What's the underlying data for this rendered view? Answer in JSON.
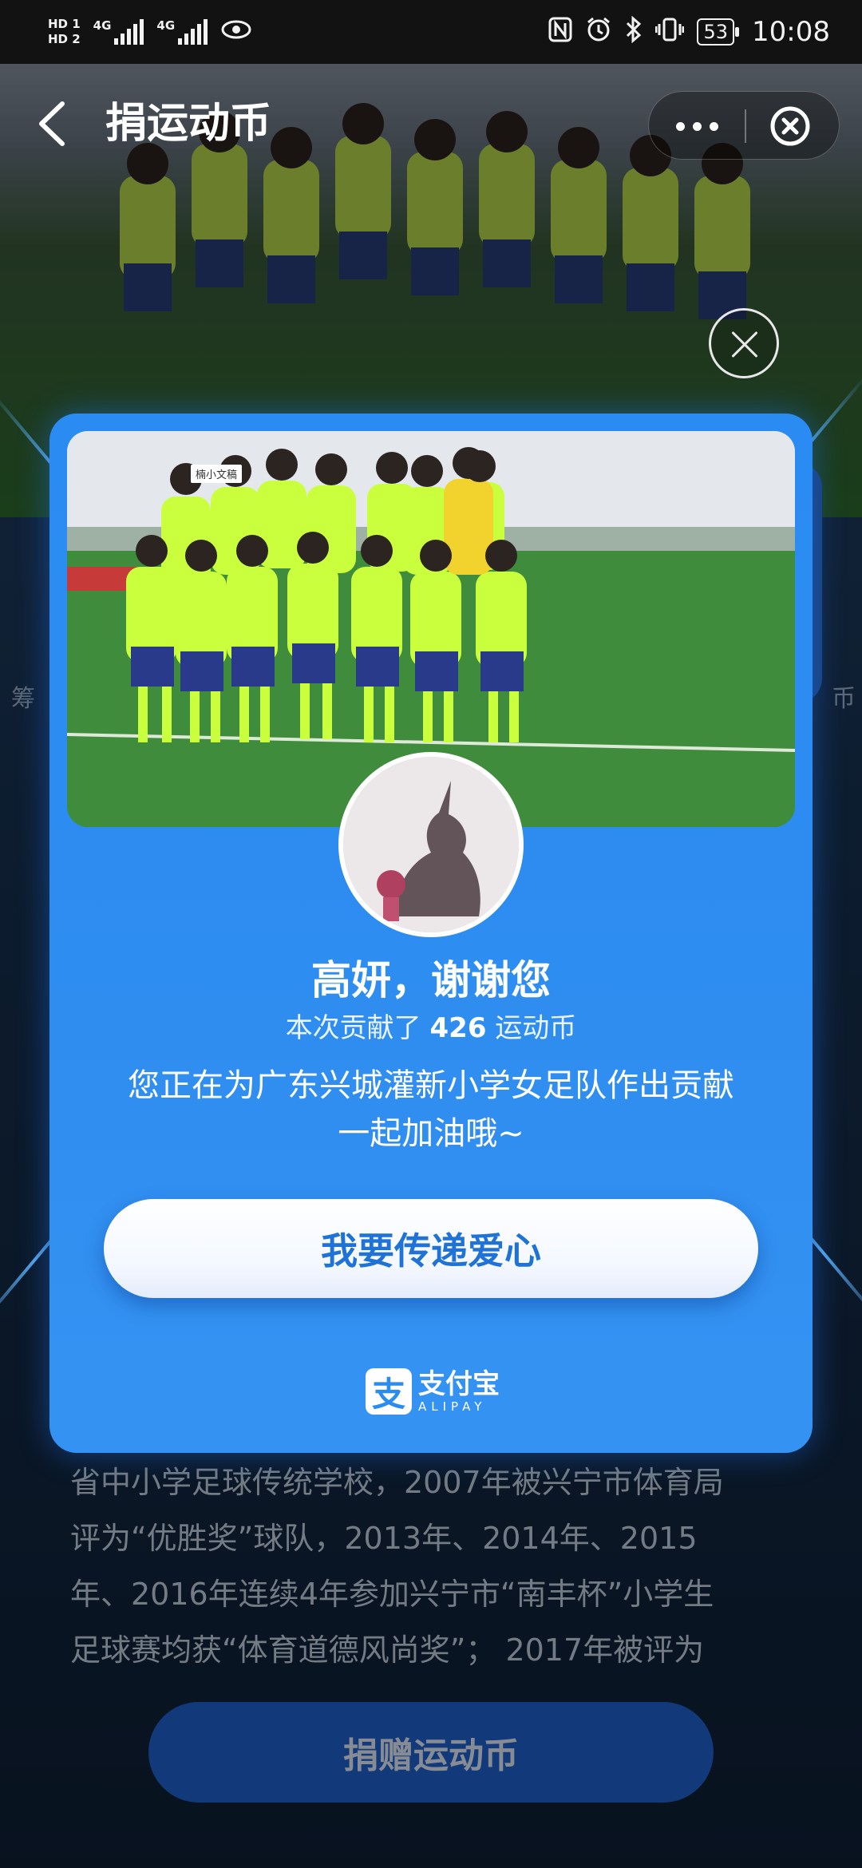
{
  "status_bar": {
    "hd1": "HD 1",
    "hd2": "HD 2",
    "net1": "4G",
    "net2": "4G",
    "battery": "53",
    "time": "10:08"
  },
  "header": {
    "title": "捐运动币"
  },
  "background": {
    "side_left": "筹",
    "side_right": "币",
    "text_lines": [
      "省中小学足球传统学校，2007年被兴宁市体育局",
      "评为“优胜奖”球队，2013年、2014年、2015",
      "年、2016年连续4年参加兴宁市“南丰杯”小学生",
      "足球赛均获“体育道德风尚奖”； 2017年被评为"
    ],
    "donate_button": "捐赠运动币"
  },
  "modal": {
    "photo_tag": "楠小文稿",
    "thanks": "高妍，谢谢您",
    "contrib_prefix": "本次贡献了",
    "contrib_amount": "426",
    "contrib_suffix": "运动币",
    "message_line1": "您正在为广东兴城灌新小学女足队作出贡献",
    "message_line2": "一起加油哦~",
    "cta_button": "我要传递爱心",
    "brand_cn": "支付宝",
    "brand_en": "ALIPAY",
    "brand_glyph": "支"
  },
  "colors": {
    "modal_blue": "#2a8bf2",
    "cta_text": "#1f72d6",
    "jersey": "#c9ff3c"
  }
}
